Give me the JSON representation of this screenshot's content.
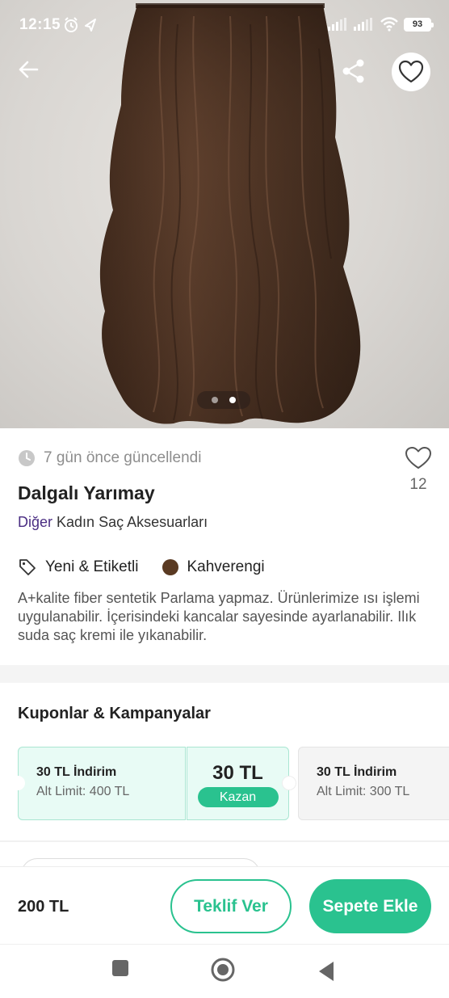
{
  "status_bar": {
    "time": "12:15",
    "battery": "93"
  },
  "hero": {
    "image_count": 2,
    "active_index": 1
  },
  "product": {
    "updated": "7 gün önce güncellendi",
    "like_count": "12",
    "title": "Dalgalı Yarımay",
    "brand": "Diğer",
    "category": "Kadın Saç Aksesuarları",
    "condition": "Yeni & Etiketli",
    "color_name": "Kahverengi",
    "color_hex": "#5a3a22",
    "description": "A+kalite fiber sentetik Parlama yapmaz. Ürünlerimize ısı işlemi uygulanabilir. İçerisindeki kancalar sayesinde ayarlanabilir. Ilık suda saç kremi ile yıkanabilir."
  },
  "coupons": {
    "section_title": "Kuponlar & Kampanyalar",
    "items": [
      {
        "title": "30 TL İndirim",
        "limit": "Alt Limit: 400 TL",
        "amount": "30 TL",
        "action": "Kazan"
      },
      {
        "title": "30 TL İndirim",
        "limit": "Alt Limit: 300 TL"
      }
    ]
  },
  "bottom_bar": {
    "price": "200 TL",
    "offer_label": "Teklif Ver",
    "cart_label": "Sepete Ekle"
  },
  "colors": {
    "accent": "#2ac28f",
    "brand": "#4b2e83"
  },
  "icons": [
    "back-arrow-icon",
    "share-icon",
    "heart-icon",
    "clock-icon",
    "tag-icon",
    "stop-icon",
    "home-icon",
    "back-triangle-icon"
  ]
}
